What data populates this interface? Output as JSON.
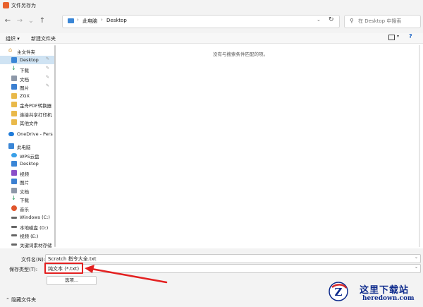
{
  "window": {
    "title": "文件另存为"
  },
  "nav": {
    "breadcrumbs": [
      "此电脑",
      "Desktop"
    ],
    "search_placeholder": "在 Desktop 中搜索"
  },
  "toolbar": {
    "organize_label": "组织 ▾",
    "new_folder_label": "新建文件夹"
  },
  "sidebar": {
    "items": [
      {
        "label": "主文件夹",
        "icon": "home-icon",
        "pinned": false,
        "selected": false
      },
      {
        "label": "Desktop",
        "icon": "desktop-folder-icon",
        "pinned": true,
        "selected": true
      },
      {
        "label": "下载",
        "icon": "download-icon",
        "pinned": true,
        "selected": false
      },
      {
        "label": "文档",
        "icon": "document-icon",
        "pinned": true,
        "selected": false
      },
      {
        "label": "图片",
        "icon": "picture-icon",
        "pinned": true,
        "selected": false
      },
      {
        "label": "ZGX",
        "icon": "folder-icon",
        "pinned": false,
        "selected": false
      },
      {
        "label": "金舟PDF转换器",
        "icon": "folder-icon",
        "pinned": false,
        "selected": false
      },
      {
        "label": "连接共享打印机",
        "icon": "folder-icon",
        "pinned": false,
        "selected": false
      },
      {
        "label": "其他文件",
        "icon": "folder-icon",
        "pinned": false,
        "selected": false
      },
      {
        "label": "OneDrive - Pers",
        "icon": "cloud-icon",
        "pinned": false,
        "selected": false
      },
      {
        "label": "此电脑",
        "icon": "computer-icon",
        "pinned": false,
        "selected": false
      },
      {
        "label": "WPS云盘",
        "icon": "cloud-icon",
        "pinned": false,
        "selected": false
      },
      {
        "label": "Desktop",
        "icon": "desktop-folder-icon",
        "pinned": false,
        "selected": false
      },
      {
        "label": "视频",
        "icon": "video-icon",
        "pinned": false,
        "selected": false
      },
      {
        "label": "图片",
        "icon": "picture-icon",
        "pinned": false,
        "selected": false
      },
      {
        "label": "文档",
        "icon": "document-icon",
        "pinned": false,
        "selected": false
      },
      {
        "label": "下载",
        "icon": "download-icon",
        "pinned": false,
        "selected": false
      },
      {
        "label": "音乐",
        "icon": "music-icon",
        "pinned": false,
        "selected": false
      },
      {
        "label": "Windows (C:)",
        "icon": "drive-icon",
        "pinned": false,
        "selected": false
      },
      {
        "label": "本地磁盘 (D:)",
        "icon": "drive-icon",
        "pinned": false,
        "selected": false
      },
      {
        "label": "视频 (E:)",
        "icon": "drive-icon",
        "pinned": false,
        "selected": false
      },
      {
        "label": "关键词素材存储",
        "icon": "drive-icon",
        "pinned": false,
        "selected": false
      }
    ]
  },
  "main": {
    "empty_message": "没有与搜索条件匹配的项。"
  },
  "bottom": {
    "filename_label": "文件名(N):",
    "filename_value": "Scratch 指令大全.txt",
    "filetype_label": "保存类型(T):",
    "filetype_value": "纯文本 (*.txt)",
    "options_button": "选项...",
    "hide_folders_label": "隐藏文件夹"
  },
  "watermark": {
    "site_cn": "这里下载站",
    "site_en": "heredown.com"
  },
  "colors": {
    "highlight": "#e32020",
    "selection": "#cfe3f3",
    "watermark": "#0d2a8c"
  }
}
